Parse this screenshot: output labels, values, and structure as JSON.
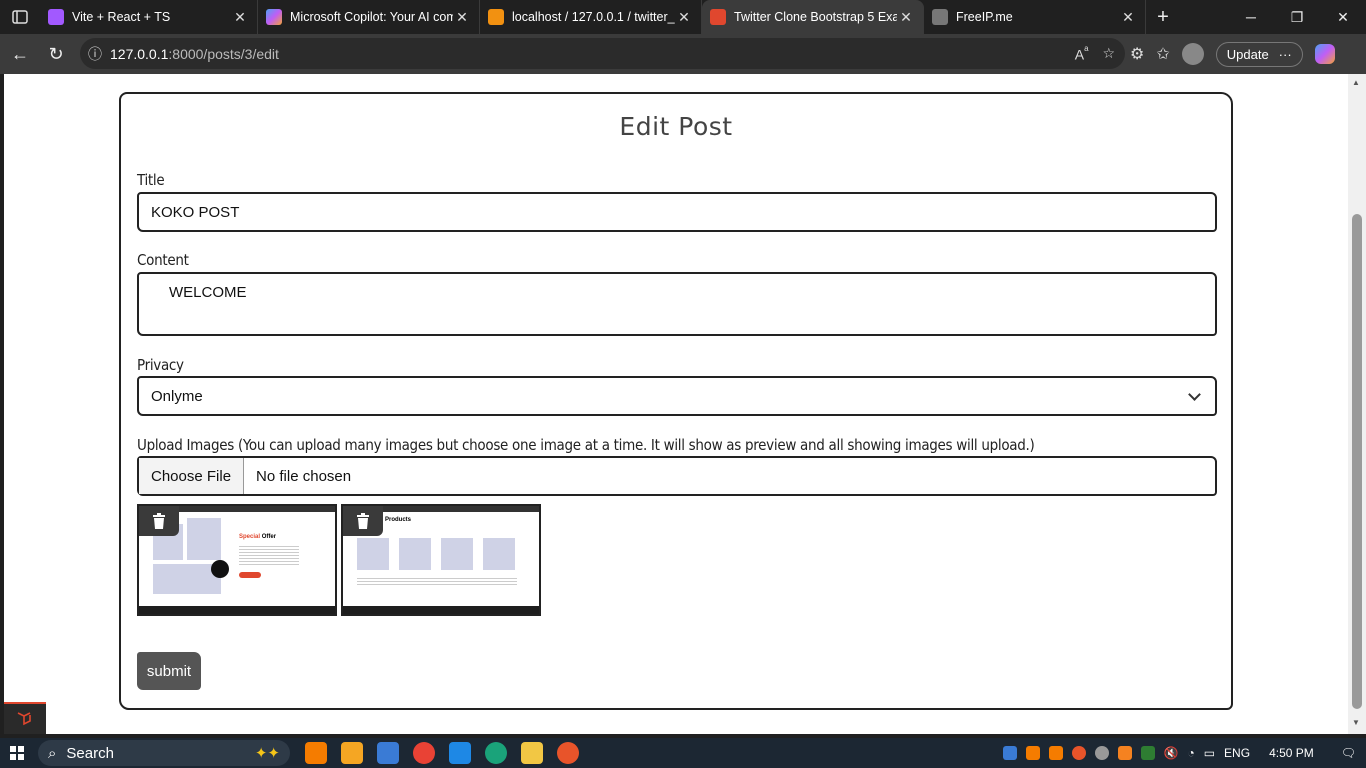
{
  "browser": {
    "tabs": [
      {
        "title": "Vite + React + TS",
        "favicon_color": "#a259ff"
      },
      {
        "title": "Microsoft Copilot: Your AI com",
        "favicon_color": "#4ea1f3"
      },
      {
        "title": "localhost / 127.0.0.1 / twitter_c",
        "favicon_color": "#f29111"
      },
      {
        "title": "Twitter Clone Bootstrap 5 Exan",
        "favicon_color": "#e0472e"
      },
      {
        "title": "FreeIP.me",
        "favicon_color": "#777777"
      }
    ],
    "url_host": "127.0.0.1",
    "url_path": ":8000/posts/3/edit",
    "update_label": "Update"
  },
  "page": {
    "heading": "Edit Post",
    "title_label": "Title",
    "title_value": "KOKO POST",
    "content_label": "Content",
    "content_value": "WELCOME",
    "privacy_label": "Privacy",
    "privacy_value": "Onlyme",
    "upload_label": "Upload Images (You can upload many images but choose one image at a time. It will show as preview and all showing images will upload.)",
    "choose_file": "Choose File",
    "no_file": "No file chosen",
    "submit_label": "submit",
    "preview1": {
      "title_a": "Special",
      "title_b": "Offer"
    },
    "preview2": {
      "title": "Products"
    }
  },
  "taskbar": {
    "search_label": "Search",
    "lang": "ENG",
    "time": "4:50 PM"
  }
}
